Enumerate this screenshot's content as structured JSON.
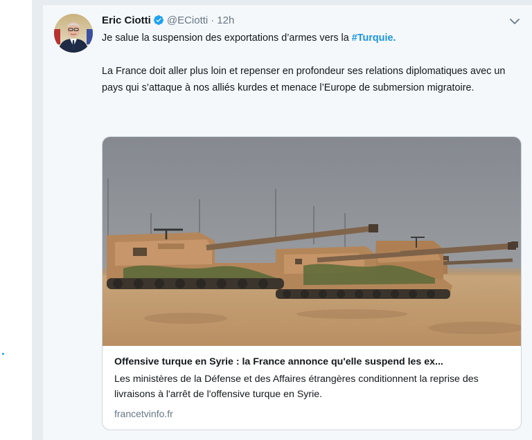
{
  "tweet": {
    "author": {
      "display_name": "Eric Ciotti",
      "verified": true,
      "handle": "@ECiotti",
      "avatar_icon": "profile-photo"
    },
    "separator": "·",
    "time": "12h",
    "text": {
      "line1_prefix": "Je salue la suspension des exportations d’armes vers la ",
      "hashtag": "#Turquie",
      "line1_suffix": ".",
      "paragraph2": "La France doit aller plus loin et repenser en profondeur ses relations diplomatiques avec un pays qui s’attaque à nos alliés kurdes et menace l’Europe de submersion migratoire."
    },
    "menu_icon": "chevron-down-icon",
    "card": {
      "image_icon": "artillery-tanks-photo",
      "title": "Offensive turque en Syrie : la France annonce qu'elle suspend les ex...",
      "description": "Les ministères de la Défense et des Affaires étrangères conditionnent la reprise des livraisons à l'arrêt de l'offensive turque en Syrie.",
      "domain": "francetvinfo.fr"
    }
  },
  "colors": {
    "link": "#1b95e0",
    "verified": "#1da1f2",
    "secondary_text": "#657786",
    "tweet_background": "#f5f8fa",
    "card_border": "#ccd6dd"
  }
}
